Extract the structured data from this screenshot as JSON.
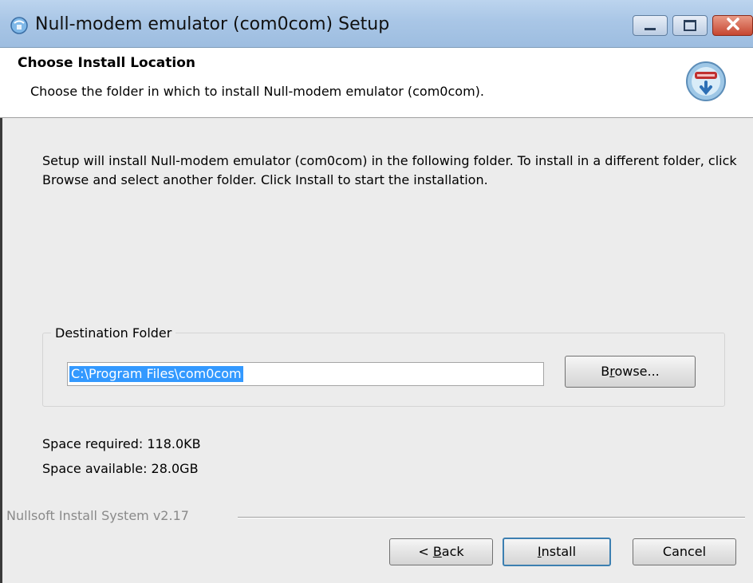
{
  "window": {
    "title": "Null-modem emulator (com0com) Setup",
    "icons": {
      "app": "installer-icon",
      "minimize": "minimize-icon",
      "maximize": "maximize-icon",
      "close": "close-icon"
    }
  },
  "header": {
    "title": "Choose Install Location",
    "subtitle": "Choose the folder in which to install Null-modem emulator (com0com).",
    "icon": "nsis-installer-icon"
  },
  "intro_text": "Setup will install Null-modem emulator (com0com) in the following folder. To install in a different folder, click Browse and select another folder. Click Install to start the installation.",
  "destination": {
    "legend": "Destination Folder",
    "path_value": "C:\\Program Files\\com0com",
    "browse_label_pre": "B",
    "browse_label_ul": "r",
    "browse_label_post": "owse..."
  },
  "space": {
    "required": "Space required: 118.0KB",
    "available": "Space available: 28.0GB"
  },
  "branding": "Nullsoft Install System v2.17",
  "buttons": {
    "back_pre": "< ",
    "back_ul": "B",
    "back_post": "ack",
    "install_ul": "I",
    "install_post": "nstall",
    "cancel": "Cancel"
  },
  "colors": {
    "selection": "#3399ff",
    "titlebar": "#a9c6e6",
    "close": "#c64630"
  }
}
